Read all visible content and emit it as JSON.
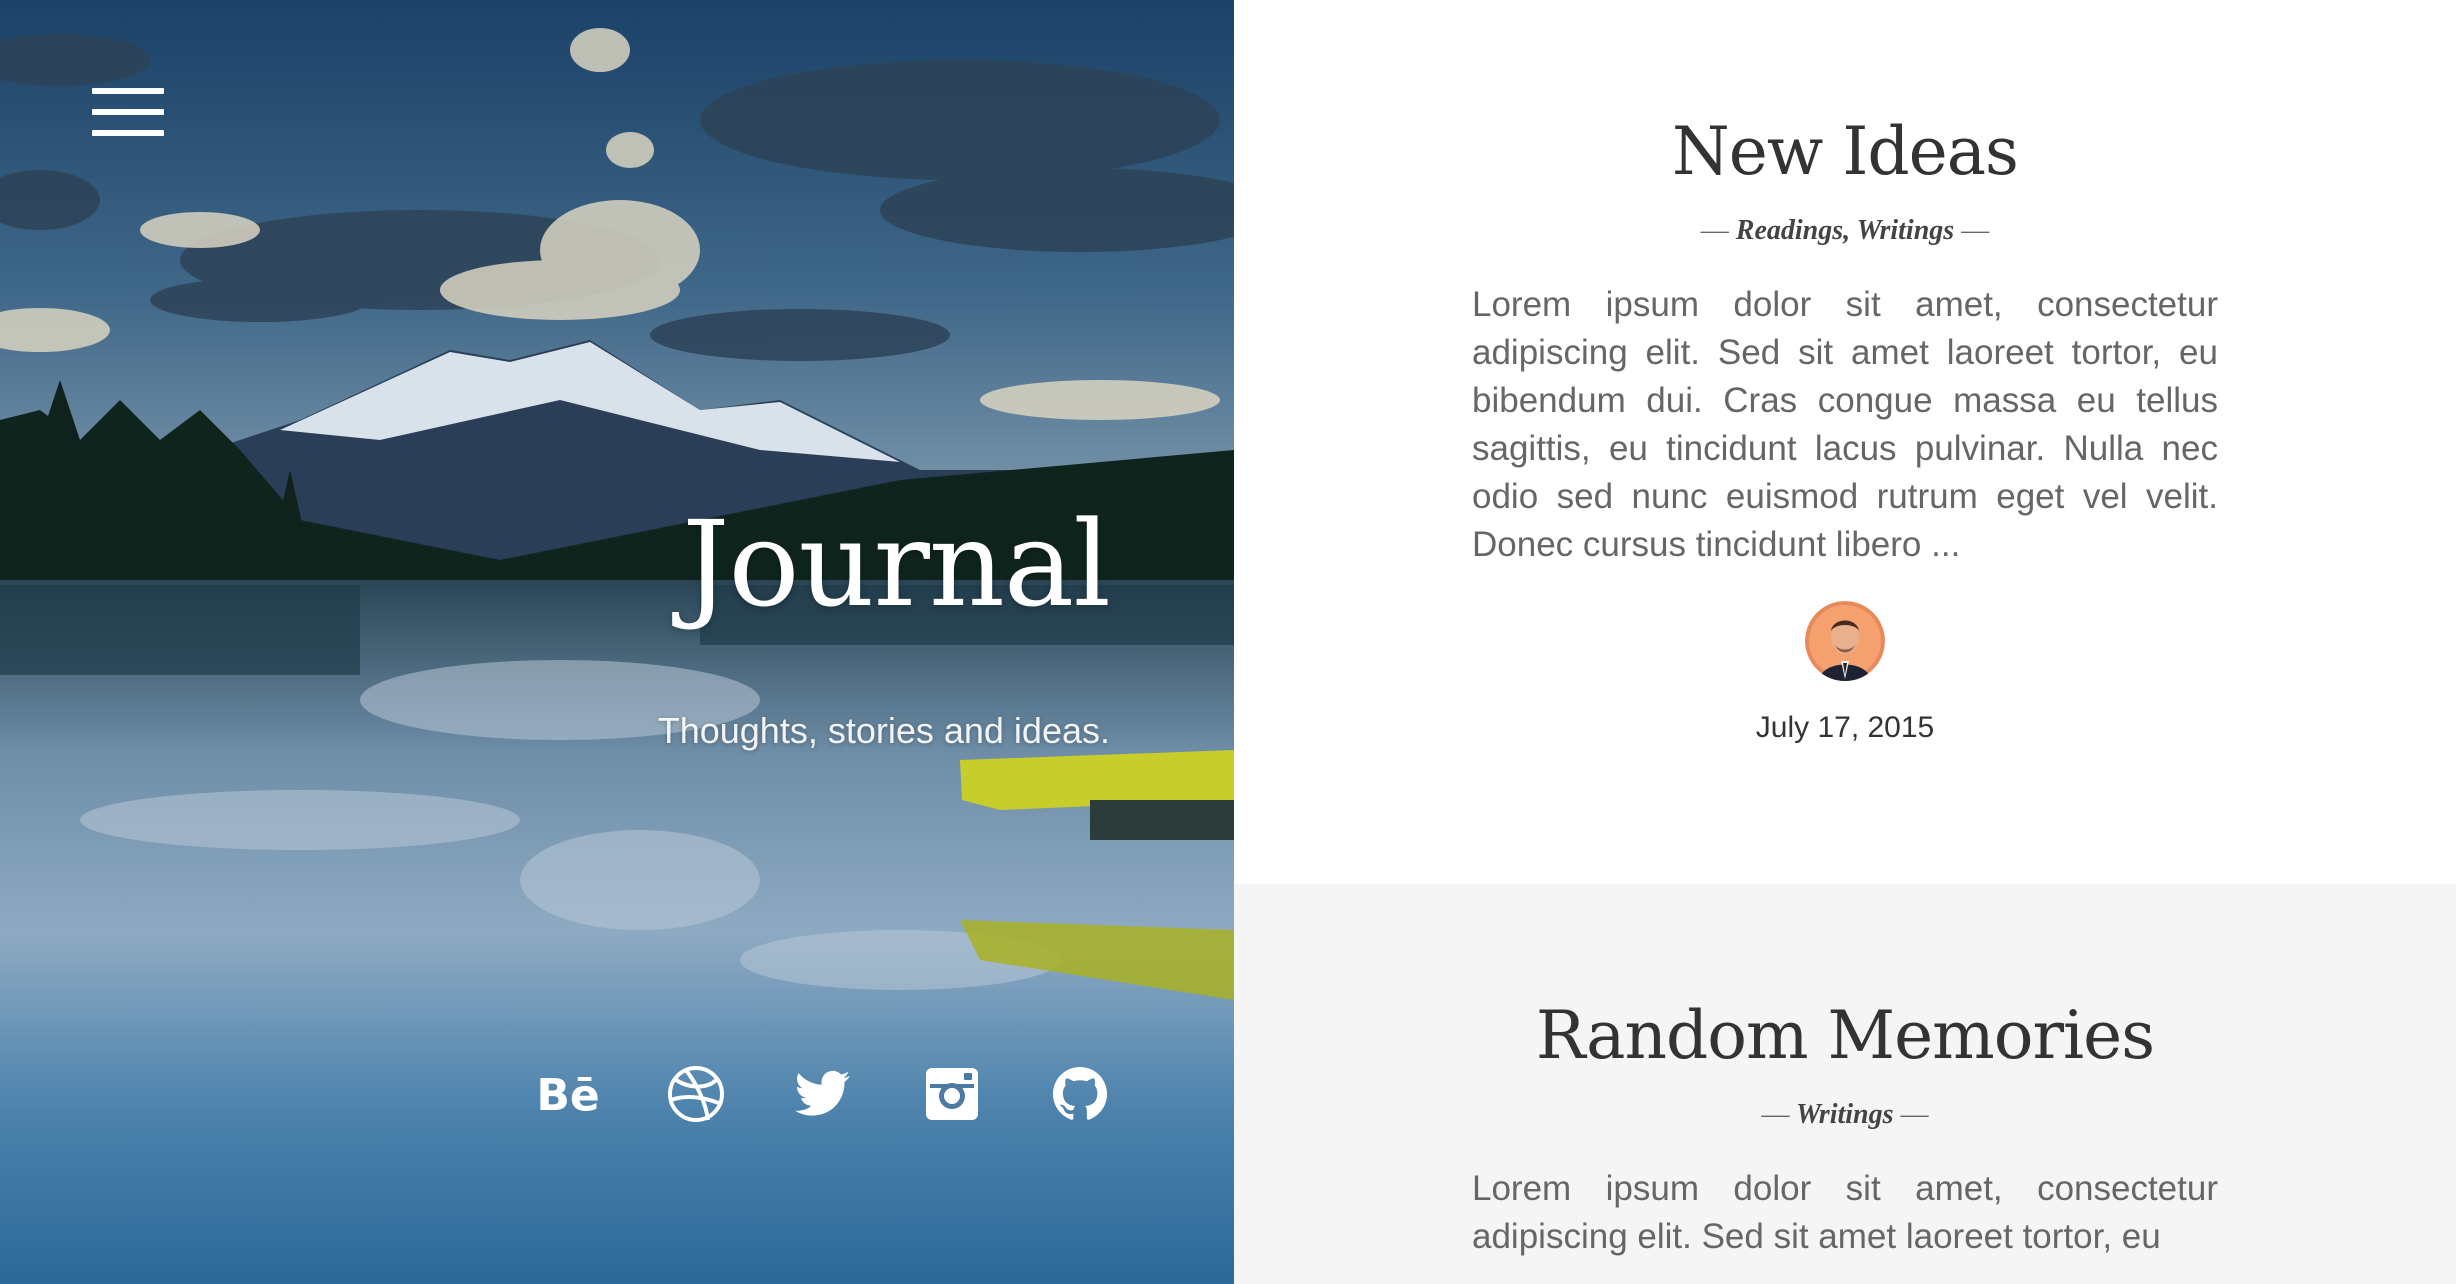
{
  "hero": {
    "title": "Journal",
    "tagline": "Thoughts, stories and ideas.",
    "menu_icon": "hamburger-menu-icon",
    "social_links": [
      {
        "name": "behance",
        "icon": "behance-icon"
      },
      {
        "name": "dribbble",
        "icon": "dribbble-icon"
      },
      {
        "name": "twitter",
        "icon": "twitter-icon"
      },
      {
        "name": "instagram",
        "icon": "instagram-icon"
      },
      {
        "name": "github",
        "icon": "github-icon"
      }
    ],
    "behance_glyph": "Bē"
  },
  "posts": [
    {
      "title": "New Ideas",
      "dash_open": "—",
      "tags": [
        "Readings",
        "Writings"
      ],
      "tag_separator": ",",
      "dash_close": "—",
      "excerpt": "Lorem ipsum dolor sit amet, consectetur adipiscing elit. Sed sit amet laoreet tortor, eu bibendum dui. Cras congue massa eu tellus sagittis, eu tincidunt lacus pulvinar. Nulla nec odio sed nunc euismod rutrum eget vel velit. Donec cursus tincidunt libero ...",
      "author_avatar": "author-avatar",
      "date": "July 17, 2015"
    },
    {
      "title": "Random Memories",
      "dash_open": "—",
      "tags": [
        "Writings"
      ],
      "dash_close": "—",
      "excerpt": "Lorem ipsum dolor sit amet, consectetur adipiscing elit. Sed sit amet laoreet tortor, eu"
    }
  ],
  "colors": {
    "text_dark": "#333333",
    "text_body": "#666666",
    "second_post_bg": "#f5f5f5",
    "kayak": "#c8cf2a"
  }
}
